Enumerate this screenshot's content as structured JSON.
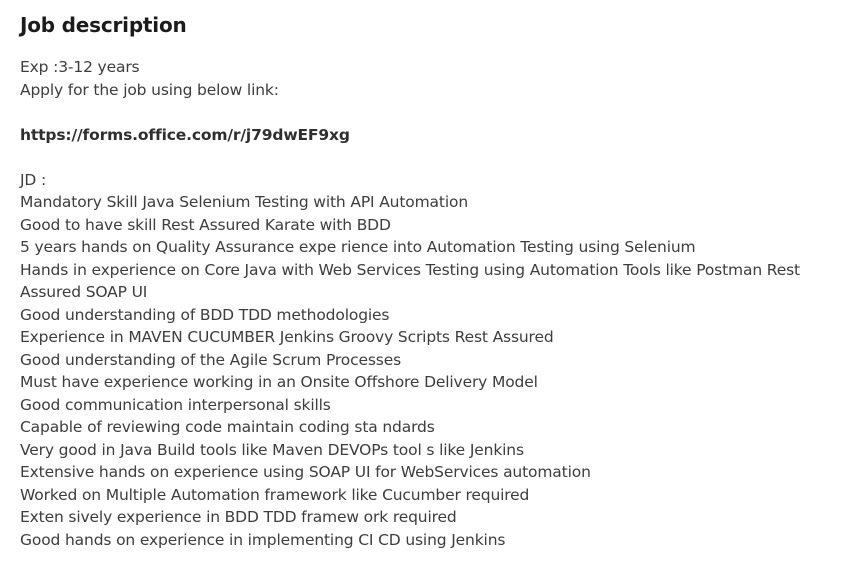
{
  "job": {
    "title": "Job description",
    "experience": "Exp :3-12 years",
    "apply_text": "Apply for the job using below link:",
    "apply_link": "https://forms.office.com/r/j79dwEF9xg",
    "jd_heading": "JD :",
    "requirements": [
      "Mandatory Skill Java Selenium Testing with API Automation",
      "Good to have skill Rest Assured Karate with BDD",
      "5 years hands on Quality Assurance expe rience into Automation Testing using Selenium",
      "Hands in experience on Core Java with Web Services Testing using Automation Tools like Postman Rest",
      "Assured SOAP UI",
      "Good understanding of BDD TDD methodologies",
      "Experience in MAVEN CUCUMBER Jenkins Groovy Scripts Rest Assured",
      "Good understanding of the Agile Scrum Processes",
      "Must have experience working in an Onsite Offshore Delivery Model",
      "Good communication interpersonal skills",
      "Capable of reviewing code maintain coding sta ndards",
      "Very good in Java Build tools like Maven DEVOPs tool s like Jenkins",
      "Extensive hands on experience using SOAP UI for WebServices automation",
      "Worked on Multiple Automation framework like Cucumber required",
      "Exten sively experience in BDD TDD framew ork required",
      "Good hands on experience in implementing CI CD using Jenkins"
    ]
  }
}
